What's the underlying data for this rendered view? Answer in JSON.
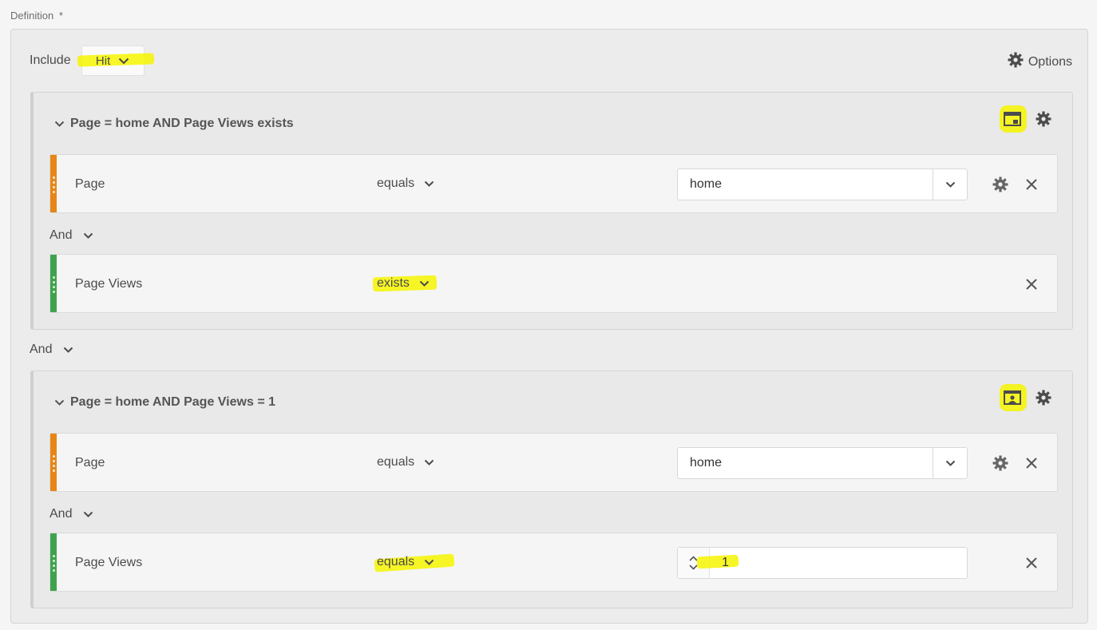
{
  "definition": {
    "label": "Definition",
    "required_mark": "*"
  },
  "include": {
    "label": "Include",
    "value": "Hit"
  },
  "options": {
    "label": "Options"
  },
  "containers": [
    {
      "title": "Page = home AND Page Views exists",
      "rules": [
        {
          "name": "Page",
          "operator": "equals",
          "value": "home",
          "color": "#e68619"
        },
        {
          "name": "Page Views",
          "operator": "exists",
          "value": "",
          "color": "#3fa34d"
        }
      ],
      "join": "And"
    },
    {
      "title": "Page = home AND Page Views = 1",
      "rules": [
        {
          "name": "Page",
          "operator": "equals",
          "value": "home",
          "color": "#e68619"
        },
        {
          "name": "Page Views",
          "operator": "equals",
          "value": "1",
          "color": "#3fa34d"
        }
      ],
      "join": "And"
    }
  ],
  "between_containers": "And",
  "icons": {
    "options": "gear-icon",
    "hit_container": "hit-container-icon",
    "visit_container": "visit-container-icon",
    "settings": "gear-icon",
    "remove": "close-icon",
    "expand": "chevron-down-icon"
  },
  "colors": {
    "dimension": "#e68619",
    "metric": "#3fa34d",
    "highlight": "#f6f400"
  }
}
